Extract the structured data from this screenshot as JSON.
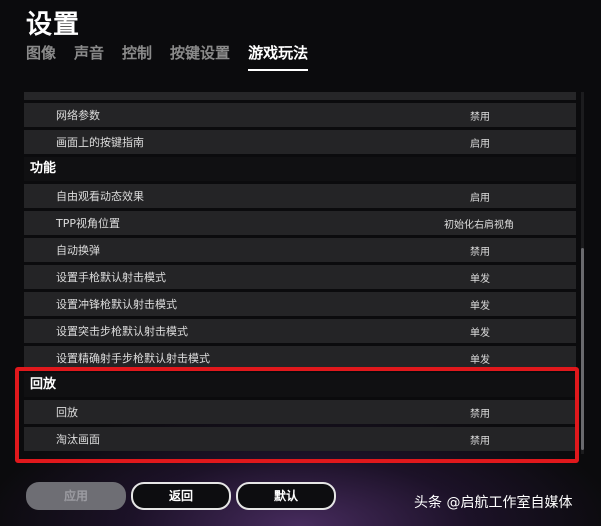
{
  "title": "设置",
  "tabs": [
    {
      "label": "图像",
      "active": false
    },
    {
      "label": "声音",
      "active": false
    },
    {
      "label": "控制",
      "active": false
    },
    {
      "label": "按键设置",
      "active": false
    },
    {
      "label": "游戏玩法",
      "active": true
    }
  ],
  "settings": {
    "top_rows": [
      {
        "label": "网络参数",
        "value": "禁用"
      },
      {
        "label": "画面上的按键指南",
        "value": "启用"
      }
    ],
    "function_section": {
      "header": "功能",
      "rows": [
        {
          "label": "自由观看动态效果",
          "value": "启用"
        },
        {
          "label": "TPP视角位置",
          "value": "初始化右肩视角"
        },
        {
          "label": "自动换弹",
          "value": "禁用"
        },
        {
          "label": "设置手枪默认射击模式",
          "value": "单发"
        },
        {
          "label": "设置冲锋枪默认射击模式",
          "value": "单发"
        },
        {
          "label": "设置突击步枪默认射击模式",
          "value": "单发"
        },
        {
          "label": "设置精确射手步枪默认射击模式",
          "value": "单发"
        }
      ]
    },
    "replay_section": {
      "header": "回放",
      "rows": [
        {
          "label": "回放",
          "value": "禁用"
        },
        {
          "label": "淘汰画面",
          "value": "禁用"
        }
      ]
    }
  },
  "buttons": {
    "apply": "应用",
    "back": "返回",
    "default": "默认"
  },
  "watermark": "头条 @启航工作室自媒体",
  "colors": {
    "highlight": "#e0181c",
    "background": "#0b0b0d",
    "row": "#242426"
  }
}
